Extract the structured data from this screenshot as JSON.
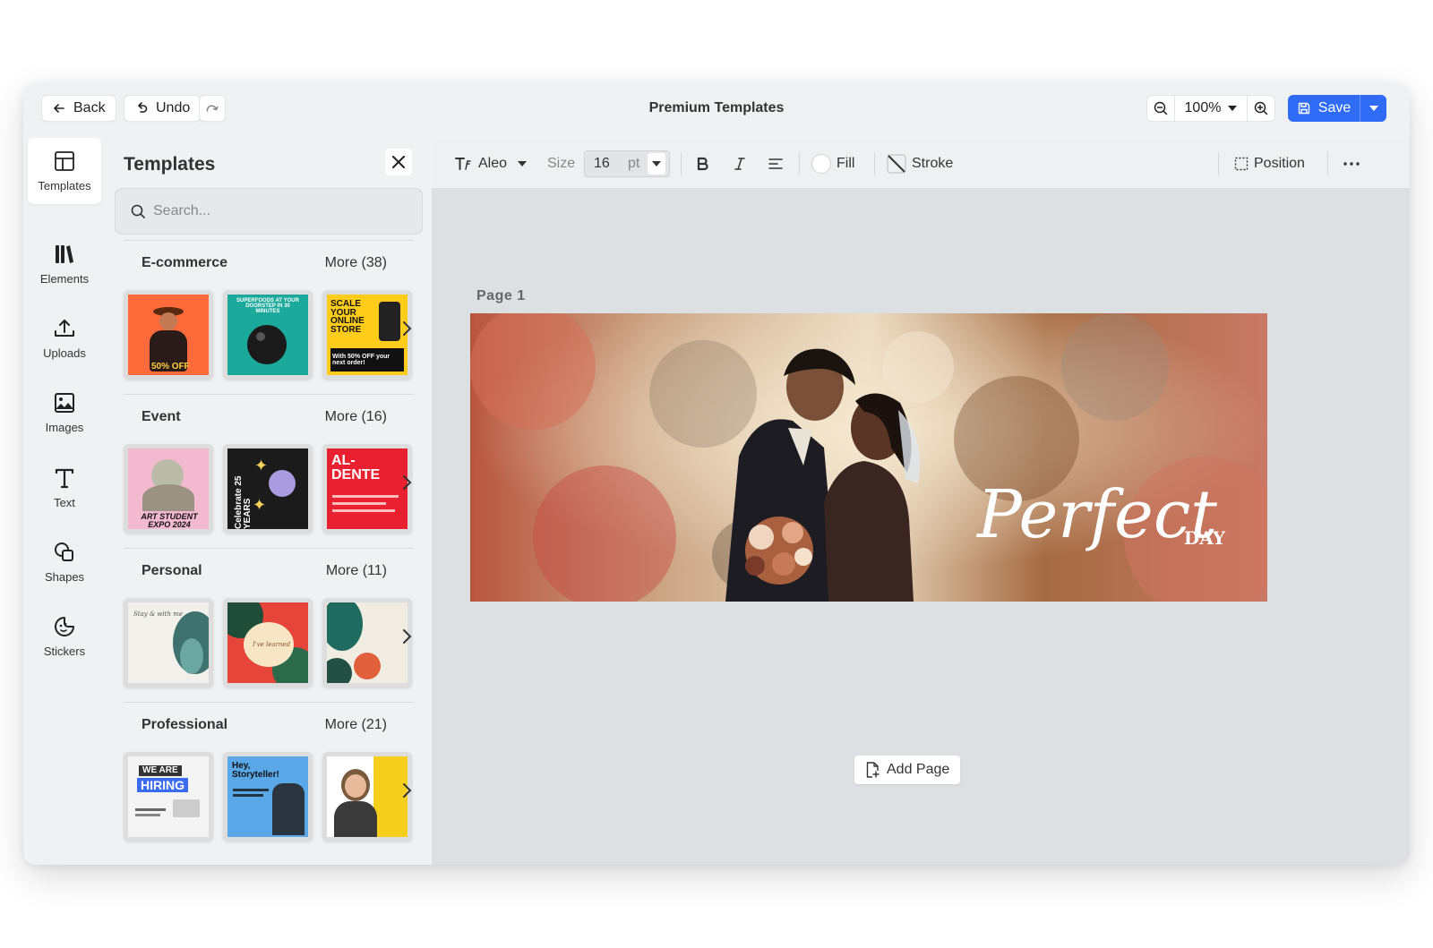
{
  "app": {
    "title": "Premium Templates"
  },
  "topbar": {
    "back_label": "Back",
    "undo_label": "Undo",
    "zoom_value": "100%",
    "save_label": "Save"
  },
  "rail": {
    "items": [
      {
        "label": "Templates",
        "icon": "layout-icon"
      },
      {
        "label": "Elements",
        "icon": "elements-icon"
      },
      {
        "label": "Uploads",
        "icon": "upload-icon"
      },
      {
        "label": "Images",
        "icon": "image-icon"
      },
      {
        "label": "Text",
        "icon": "text-icon"
      },
      {
        "label": "Shapes",
        "icon": "shapes-icon"
      },
      {
        "label": "Stickers",
        "icon": "sticker-icon"
      }
    ]
  },
  "panel": {
    "title": "Templates",
    "search_placeholder": "Search...",
    "categories": [
      {
        "name": "E-commerce",
        "more": "More (38)",
        "thumbs": [
          {
            "text": "50% OFF"
          },
          {
            "text": "SUPERFOODS AT YOUR DOORSTEP IN 30 MINUTES"
          },
          {
            "text": "SCALE YOUR ONLINE STORE",
            "sub": "With 50% OFF your next order!"
          }
        ]
      },
      {
        "name": "Event",
        "more": "More (16)",
        "thumbs": [
          {
            "text": "ART STUDENT EXPO 2024"
          },
          {
            "text": "Celebrate 25 YEARS"
          },
          {
            "text": "AL-DENTE"
          }
        ]
      },
      {
        "name": "Personal",
        "more": "More (11)",
        "thumbs": [
          {
            "text": "Stay & with me"
          },
          {
            "text": "I've learned"
          },
          {
            "text": ""
          }
        ]
      },
      {
        "name": "Professional",
        "more": "More (21)",
        "thumbs": [
          {
            "text": "WE ARE",
            "sub": "HIRING"
          },
          {
            "text": "Hey, Storyteller!"
          },
          {
            "text": ""
          }
        ]
      }
    ]
  },
  "format_bar": {
    "font_name": "Aleo",
    "size_label": "Size",
    "size_value": "16",
    "size_unit": "pt",
    "fill_label": "Fill",
    "stroke_label": "Stroke",
    "position_label": "Position"
  },
  "canvas": {
    "page_label": "Page  1",
    "headline_script": "Perfect",
    "headline_caps": "DAY",
    "add_page_label": "Add Page"
  },
  "colors": {
    "accent": "#2f6bf5",
    "window_bg": "#eef0f2",
    "canvas_bg": "#dde0e3"
  }
}
